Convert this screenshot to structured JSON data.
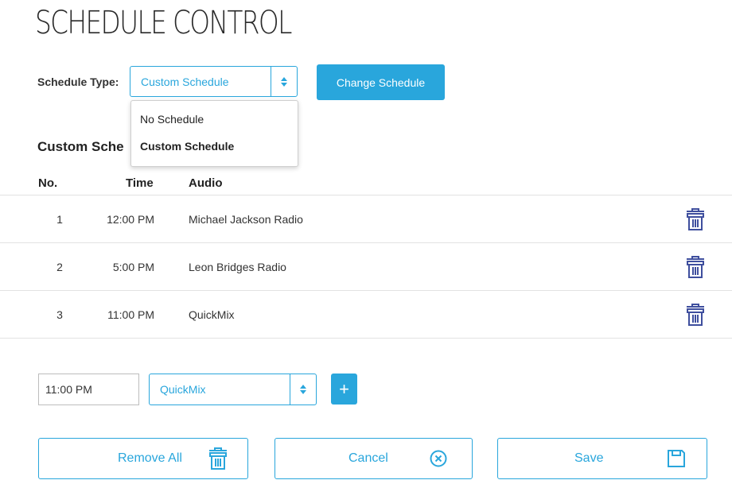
{
  "page_title": "SCHEDULE CONTROL",
  "schedule_type": {
    "label": "Schedule Type:",
    "selected": "Custom Schedule",
    "options": [
      "No Schedule",
      "Custom Schedule"
    ],
    "change_button": "Change Schedule"
  },
  "section_title": "Custom Sche",
  "table": {
    "headers": {
      "no": "No.",
      "time": "Time",
      "audio": "Audio"
    },
    "rows": [
      {
        "no": "1",
        "time": "12:00 PM",
        "audio": "Michael Jackson Radio"
      },
      {
        "no": "2",
        "time": "5:00 PM",
        "audio": "Leon Bridges Radio"
      },
      {
        "no": "3",
        "time": "11:00 PM",
        "audio": "QuickMix"
      }
    ]
  },
  "add_entry": {
    "time_value": "11:00 PM",
    "audio_selected": "QuickMix",
    "add_button": "+"
  },
  "actions": {
    "remove_all": "Remove All",
    "cancel": "Cancel",
    "save": "Save"
  },
  "icons": {
    "trash": "trash-icon",
    "cancel": "circle-x-icon",
    "save": "floppy-disk-icon",
    "select_arrows": "select-arrows-icon"
  },
  "colors": {
    "accent": "#29a6dc",
    "delete_icon": "#3f4f9e"
  }
}
